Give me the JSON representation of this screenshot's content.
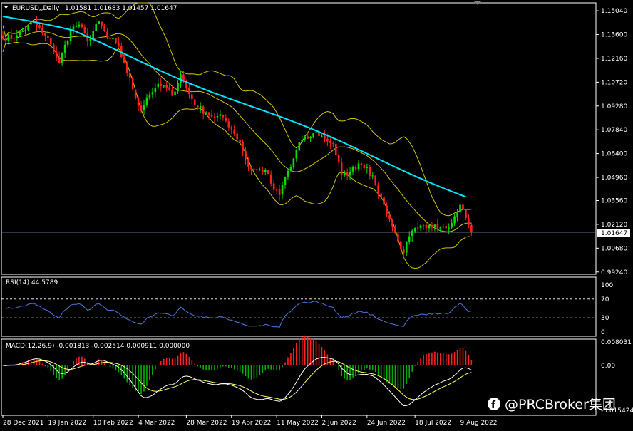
{
  "chart_data": {
    "type": "candlestick",
    "symbol_label": "EURUSD,,Daily",
    "ohlc_label": "1.01581 1.01683 1.01457 1.01647",
    "last_price": "1.01647",
    "price_ticks": [
      "1.15040",
      "1.13600",
      "1.12160",
      "1.10720",
      "1.09280",
      "1.07840",
      "1.06400",
      "1.04960",
      "1.03560",
      "1.02120",
      "1.00680",
      "0.99240"
    ],
    "price_range": [
      0.991,
      1.1552
    ],
    "date_labels": [
      "28 Dec 2021",
      "19 Jan 2022",
      "10 Feb 2022",
      "4 Mar 2022",
      "28 Mar 2022",
      "19 Apr 2022",
      "11 May 2022",
      "2 Jun 2022",
      "24 Jun 2022",
      "18 Jul 2022",
      "9 Aug 2022"
    ],
    "date_label_index": [
      0,
      16,
      32,
      48,
      65,
      81,
      97,
      113,
      129,
      146,
      162
    ],
    "close_anchors": [
      [
        0,
        1.1335
      ],
      [
        5,
        1.1355
      ],
      [
        11,
        1.1435
      ],
      [
        14,
        1.137
      ],
      [
        17,
        1.13
      ],
      [
        20,
        1.119
      ],
      [
        24,
        1.139
      ],
      [
        27,
        1.142
      ],
      [
        30,
        1.132
      ],
      [
        34,
        1.144
      ],
      [
        37,
        1.134
      ],
      [
        40,
        1.131
      ],
      [
        43,
        1.119
      ],
      [
        46,
        1.103
      ],
      [
        49,
        1.09
      ],
      [
        51,
        1.098
      ],
      [
        54,
        1.104
      ],
      [
        57,
        1.105
      ],
      [
        60,
        1.099
      ],
      [
        63,
        1.112
      ],
      [
        66,
        1.1
      ],
      [
        69,
        1.092
      ],
      [
        72,
        1.089
      ],
      [
        75,
        1.086
      ],
      [
        78,
        1.086
      ],
      [
        81,
        1.079
      ],
      [
        84,
        1.071
      ],
      [
        87,
        1.056
      ],
      [
        90,
        1.054
      ],
      [
        93,
        1.054
      ],
      [
        96,
        1.042
      ],
      [
        98,
        1.039
      ],
      [
        100,
        1.05
      ],
      [
        102,
        1.056
      ],
      [
        105,
        1.071
      ],
      [
        108,
        1.073
      ],
      [
        111,
        1.077
      ],
      [
        114,
        1.073
      ],
      [
        117,
        1.07
      ],
      [
        120,
        1.051
      ],
      [
        123,
        1.053
      ],
      [
        126,
        1.058
      ],
      [
        129,
        1.056
      ],
      [
        132,
        1.045
      ],
      [
        135,
        1.033
      ],
      [
        138,
        1.02
      ],
      [
        140,
        1.011
      ],
      [
        142,
        1.004
      ],
      [
        144,
        1.014
      ],
      [
        147,
        1.019
      ],
      [
        150,
        1.019
      ],
      [
        153,
        1.021
      ],
      [
        156,
        1.02
      ],
      [
        159,
        1.022
      ],
      [
        162,
        1.033
      ],
      [
        164,
        1.025
      ],
      [
        166,
        1.0165
      ]
    ],
    "rsi": {
      "label": "RSI(14) 44.5789",
      "ticks": [
        "100",
        "70",
        "30",
        "0"
      ],
      "tick_values": [
        100,
        70,
        30,
        0
      ],
      "levels": [
        70,
        30
      ],
      "last_value": 44.5789
    },
    "macd": {
      "label": "MACD(12,26,9) -0.001813 -0.002514 0.000911 0.000000",
      "ticks": [
        "0.008031",
        "0.00",
        "-0.015424"
      ],
      "tick_values": [
        0.008031,
        0.0,
        -0.015424
      ]
    },
    "colors": {
      "background": "#000000",
      "bull": "#00e000",
      "bear": "#ff2020",
      "bollinger": "#d4c400",
      "ma": "#00e5ff",
      "rsi": "#4a78e0",
      "macd_up": "#ff2020",
      "macd_down": "#00b000",
      "macd_signal": "#ffff66",
      "macd_line": "#ffffff",
      "grid": "#ffffff"
    }
  },
  "watermark": "@PRCBroker集团"
}
